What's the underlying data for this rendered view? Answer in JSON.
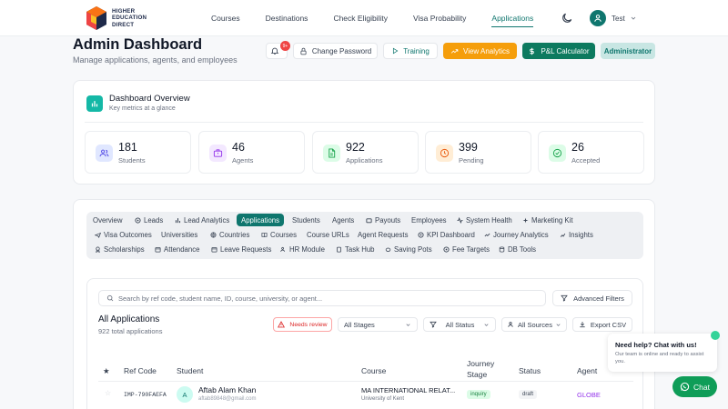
{
  "brand": {
    "line1": "HIGHER",
    "line2": "EDUCATION",
    "line3": "DIRECT"
  },
  "nav": {
    "links": [
      "Courses",
      "Destinations",
      "Check Eligibility",
      "Visa Probability",
      "Applications"
    ],
    "active": "Applications",
    "user": "Test"
  },
  "header": {
    "title": "Admin Dashboard",
    "subtitle": "Manage applications, agents, and employees",
    "notif_badge": "9+",
    "change_password": "Change Password",
    "training": "Training",
    "view_analytics": "View Analytics",
    "pl_calculator": "P&L Calculator",
    "role": "Administrator"
  },
  "overview": {
    "title": "Dashboard Overview",
    "subtitle": "Key metrics at a glance",
    "stats": [
      {
        "value": "181",
        "label": "Students",
        "icon": "users-icon",
        "color": "#e0e7ff",
        "fg": "#4f46e5"
      },
      {
        "value": "46",
        "label": "Agents",
        "icon": "briefcase-icon",
        "color": "#f3e8ff",
        "fg": "#9333ea"
      },
      {
        "value": "922",
        "label": "Applications",
        "icon": "document-icon",
        "color": "#dcfce7",
        "fg": "#16a34a"
      },
      {
        "value": "399",
        "label": "Pending",
        "icon": "clock-icon",
        "color": "#ffedd5",
        "fg": "#ea580c"
      },
      {
        "value": "26",
        "label": "Accepted",
        "icon": "check-circle-icon",
        "color": "#dcfce7",
        "fg": "#16a34a"
      }
    ]
  },
  "tabs": {
    "row1": [
      "Overview",
      "Leads",
      "Lead Analytics",
      "Applications",
      "Students",
      "Agents",
      "Payouts",
      "Employees",
      "System Health",
      "Marketing Kit"
    ],
    "row2": [
      "Visa Outcomes",
      "Universities",
      "Countries",
      "Courses",
      "Course URLs",
      "Agent Requests",
      "KPI Dashboard",
      "Journey Analytics",
      "Insights"
    ],
    "row3": [
      "Scholarships",
      "Attendance",
      "Leave Requests",
      "HR Module",
      "Task Hub",
      "Saving Pots",
      "Fee Targets",
      "DB Tools"
    ],
    "active": "Applications"
  },
  "applications": {
    "search_placeholder": "Search by ref code, student name, ID, course, university, or agent...",
    "advanced_filters": "Advanced Filters",
    "title": "All Applications",
    "count": "922 total applications",
    "needs_review": "Needs review",
    "stages": "All Stages",
    "status": "All Status",
    "sources": "All Sources",
    "export": "Export CSV",
    "columns": [
      "Ref Code",
      "Student",
      "Course",
      "Journey Stage",
      "Status",
      "Agent"
    ],
    "rows": [
      {
        "ref": "IMP-790FAEFA",
        "initial": "A",
        "name": "Aftab Alam Khan",
        "email": "aftab89848@gmail.com",
        "course": "MA INTERNATIONAL RELAT...",
        "university": "University of Kent",
        "stage": "inquiry",
        "status": "draft",
        "agent": "GLOBE"
      }
    ]
  },
  "chat": {
    "title": "Need help? Chat with us!",
    "subtitle": "Our team is online and ready to assist you.",
    "button": "Chat"
  }
}
